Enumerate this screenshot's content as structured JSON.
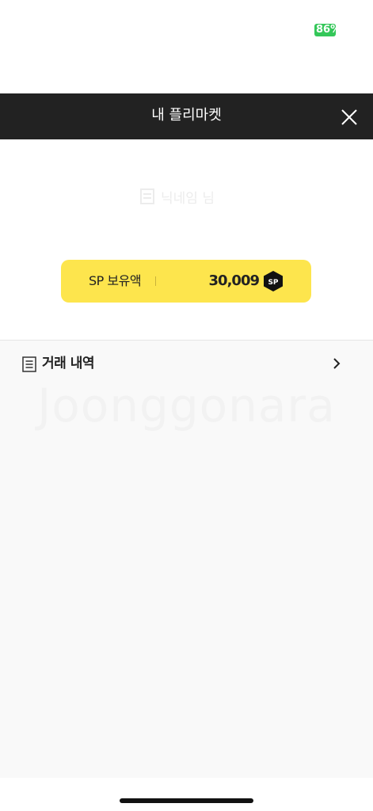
{
  "status_bar": {
    "battery_text": "86%",
    "battery_color": "#34c759"
  },
  "header": {
    "title": "내 플리마켓",
    "close_icon": "close-icon"
  },
  "profile": {
    "faded_label": "닉네임 님",
    "sp_card": {
      "label": "SP 보유액",
      "amount": "30,009",
      "badge_text": "SP",
      "background_color": "#fde54d"
    }
  },
  "history": {
    "label": "거래 내역",
    "icon": "document-icon",
    "chevron_icon": "chevron-right-icon"
  },
  "watermark": "Joonggonara",
  "colors": {
    "header_bg": "#222222",
    "content_bg": "#f9f9f9"
  }
}
